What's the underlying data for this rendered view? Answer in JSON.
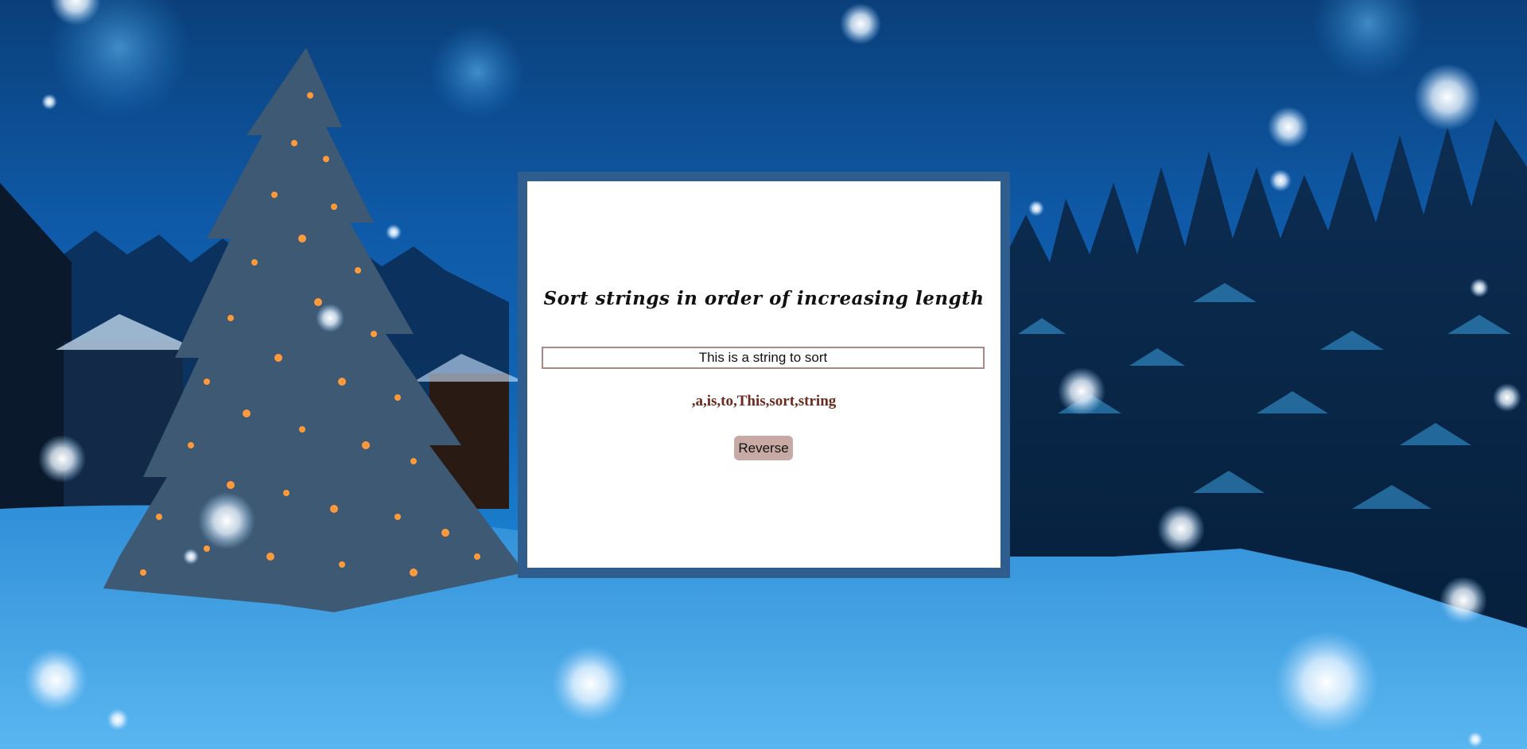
{
  "title": "Sort strings in order of increasing length",
  "input": {
    "value": "This is a string to sort"
  },
  "result": ",a,is,to,This,sort,string",
  "reverse_button": {
    "label": "Reverse"
  },
  "colors": {
    "frame": "#2f5e8e",
    "result_text": "#6b2a1d",
    "button_bg": "#c8aaa4",
    "input_border": "#a88a84"
  }
}
